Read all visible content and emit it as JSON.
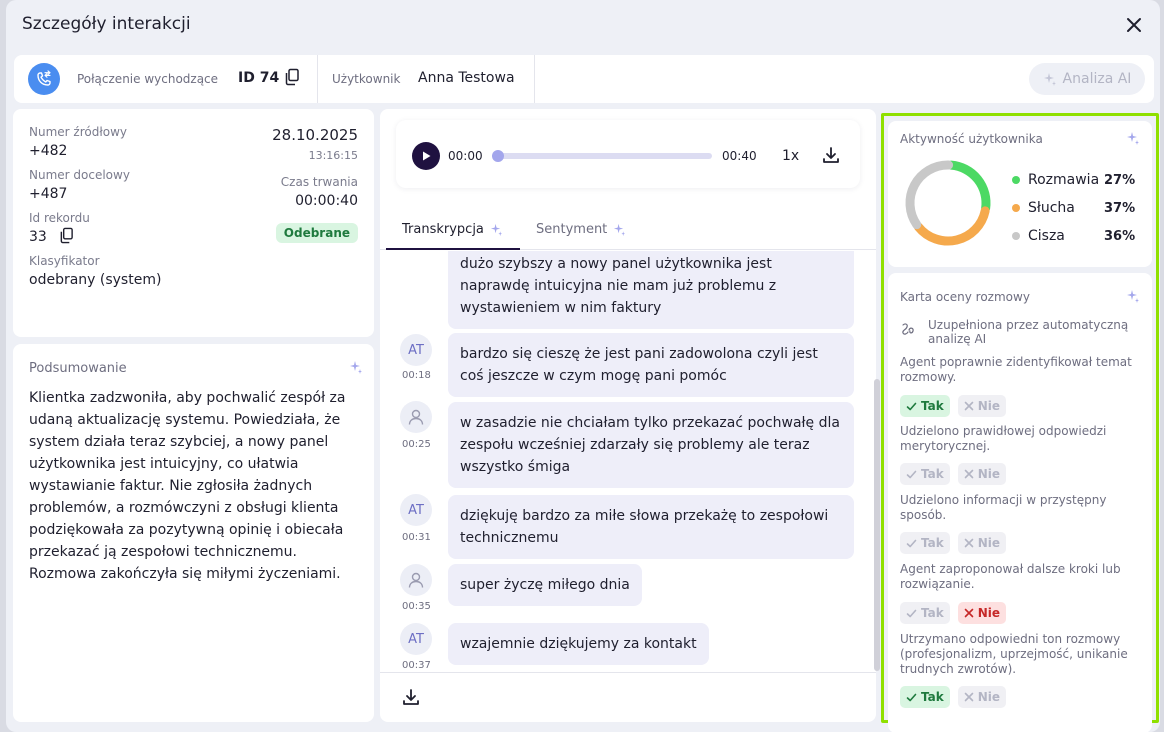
{
  "modal": {
    "title": "Szczegóły interakcji"
  },
  "info": {
    "call_type": "Połączenie wychodzące",
    "call_id": "ID 74",
    "user_label": "Użytkownik",
    "user_name": "Anna Testowa",
    "ai_button": "Analiza AI"
  },
  "details": {
    "source_label": "Numer źródłowy",
    "source_value": "+482",
    "target_label": "Numer docelowy",
    "target_value": "+487",
    "record_label": "Id rekordu",
    "record_value": "33",
    "classifier_label": "Klasyfikator",
    "classifier_value": "odebrany (system)",
    "date": "28.10.2025",
    "time": "13:16:15",
    "duration_label": "Czas trwania",
    "duration_value": "00:00:40",
    "status": "Odebrane"
  },
  "summary": {
    "title": "Podsumowanie",
    "text": "Klientka zadzwoniła, aby pochwalić zespół za udaną aktualizację systemu. Powiedziała, że system działa teraz szybciej, a nowy panel użytkownika jest intuicyjny, co ułatwia wystawianie faktur. Nie zgłosiła żadnych problemów, a rozmówczyni z obsługi klienta podziękowała za pozytywną opinię i obiecała przekazać ją zespołowi technicznemu. Rozmowa zakończyła się miłymi życzeniami."
  },
  "player": {
    "current": "00:00",
    "total": "00:40",
    "speed": "1x",
    "progress": 0
  },
  "tabs": [
    {
      "label": "Transkrypcja"
    },
    {
      "label": "Sentyment"
    }
  ],
  "transcript": [
    {
      "speaker": "",
      "initials": "",
      "time": "",
      "text": "dużo szybszy a nowy panel użytkownika jest naprawdę intuicyjna nie mam już problemu z wystawieniem w nim faktury"
    },
    {
      "speaker": "agent",
      "initials": "AT",
      "time": "00:18",
      "text": "bardzo się cieszę że jest pani zadowolona czyli jest coś jeszcze w czym mogę pani pomóc"
    },
    {
      "speaker": "client",
      "initials": "",
      "time": "00:25",
      "text": "w zasadzie nie chciałam tylko przekazać pochwałę dla zespołu wcześniej zdarzały się problemy ale teraz wszystko śmiga"
    },
    {
      "speaker": "agent",
      "initials": "AT",
      "time": "00:31",
      "text": "dziękuję bardzo za miłe słowa przekażę to zespołowi technicznemu"
    },
    {
      "speaker": "client",
      "initials": "",
      "time": "00:35",
      "text": "super życzę miłego dnia"
    },
    {
      "speaker": "agent",
      "initials": "AT",
      "time": "00:37",
      "text": "wzajemnie dziękujemy za kontakt"
    }
  ],
  "activity": {
    "title": "Aktywność użytkownika",
    "items": [
      {
        "label": "Rozmawia",
        "pct": "27%",
        "value": 27,
        "color": "#4cd964"
      },
      {
        "label": "Słucha",
        "pct": "37%",
        "value": 37,
        "color": "#f5a94c"
      },
      {
        "label": "Cisza",
        "pct": "36%",
        "value": 36,
        "color": "#c8c8c8"
      }
    ]
  },
  "scorecard": {
    "title": "Karta oceny rozmowy",
    "auto_note": "Uzupełniona przez automatyczną analizę AI",
    "yes_label": "Tak",
    "no_label": "Nie",
    "questions": [
      {
        "text": "Agent poprawnie zidentyfikował temat rozmowy.",
        "answer": "yes"
      },
      {
        "text": "Udzielono prawidłowej odpowiedzi merytorycznej.",
        "answer": "none"
      },
      {
        "text": "Udzielono informacji w przystępny sposób.",
        "answer": "none"
      },
      {
        "text": "Agent zaproponował dalsze kroki lub rozwiązanie.",
        "answer": "no"
      },
      {
        "text": "Utrzymano odpowiedni ton rozmowy (profesjonalizm, uprzejmość, unikanie trudnych zwrotów).",
        "answer": "yes"
      }
    ]
  },
  "colors": {
    "accent": "#1f1140",
    "call_icon": "#4a8df0",
    "highlight_border": "#8fe000"
  }
}
